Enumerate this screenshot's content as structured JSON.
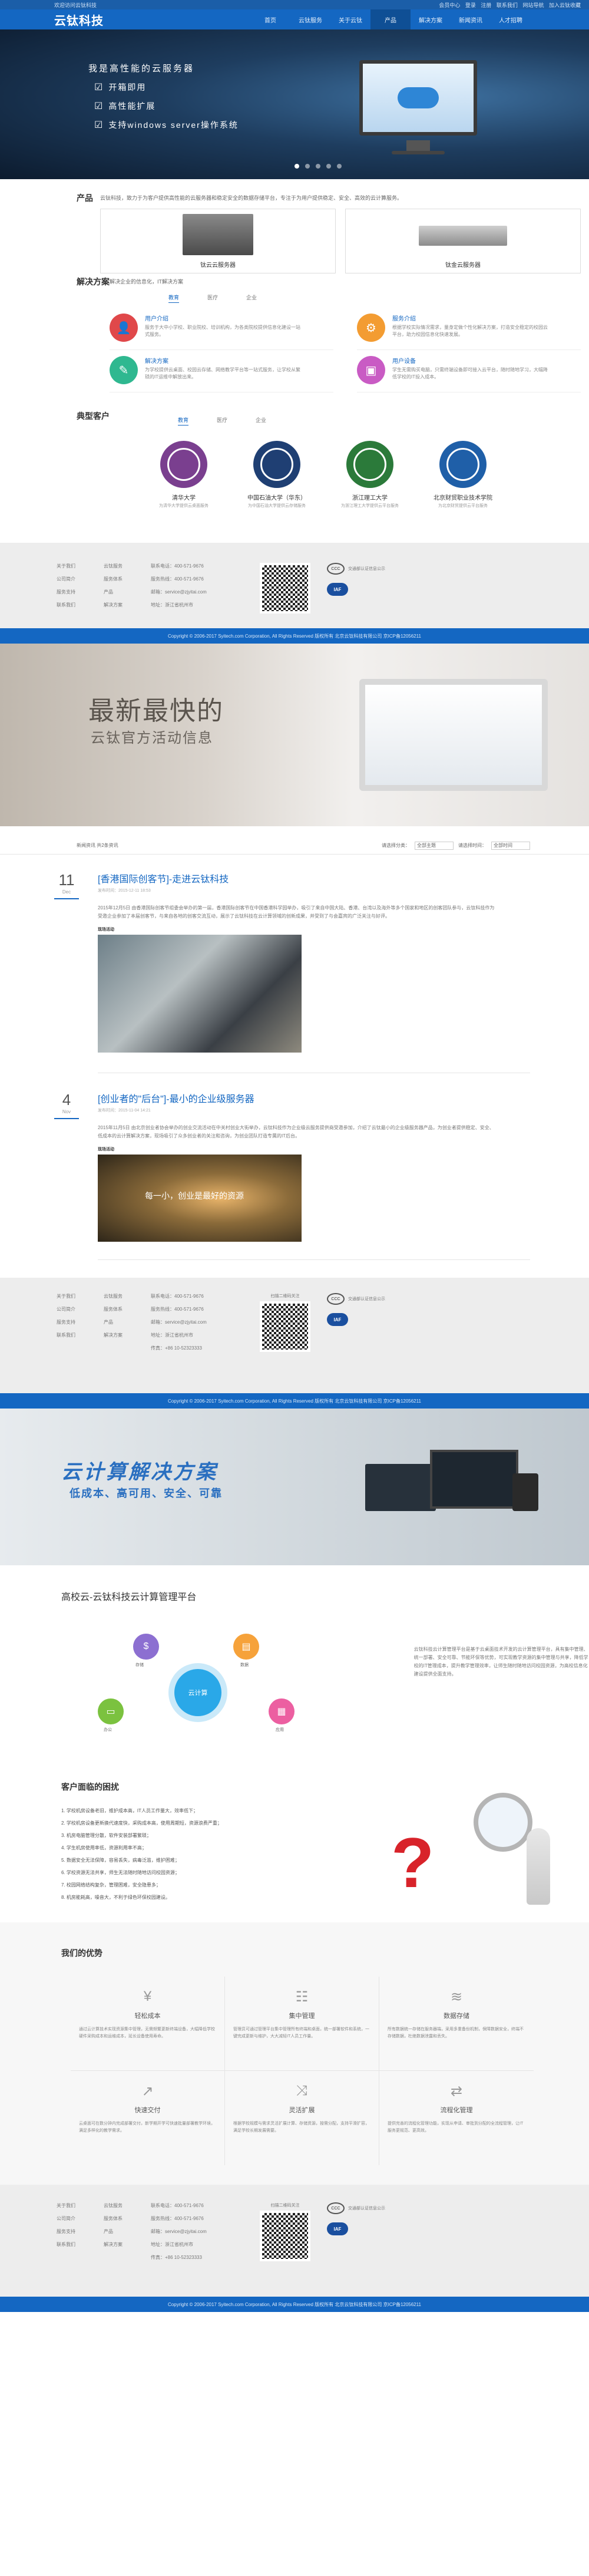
{
  "topbar": {
    "left": "欢迎访问云钛科技",
    "right": [
      "会员中心",
      "登录",
      "注册",
      "联系我们",
      "网站导航",
      "加入云钛收藏"
    ]
  },
  "header": {
    "logo": "云钛科技",
    "nav": [
      "首页",
      "云钛服务",
      "关于云钛",
      "产品",
      "解决方案",
      "新闻资讯",
      "人才招聘"
    ],
    "active_index": 3
  },
  "hero": {
    "title": "我是高性能的云服务器",
    "lines": [
      "开箱即用",
      "高性能扩展",
      "支持windows server操作系统"
    ],
    "slides": 5,
    "active_slide": 0
  },
  "products": {
    "title": "产品",
    "intro": "云钛科技，致力于为客户提供高性能的云服务器和稳定安全的数据存储平台，专注于为用户提供稳定、安全、高效的云计算服务。",
    "items": [
      {
        "name": "钛云云服务器"
      },
      {
        "name": "钛金云服务器"
      }
    ]
  },
  "solutions": {
    "title": "解决方案",
    "intro": "解决企业的信息化，IT解决方案",
    "tabs": [
      "教育",
      "医疗",
      "企业"
    ],
    "active_tab": 0,
    "items": [
      {
        "title": "用户介绍",
        "desc": "服务于大中小学校、职业院校、培训机构，为各类院校提供信息化建设一站式服务。",
        "color": "#e0484a",
        "icon": "user-icon"
      },
      {
        "title": "服务介绍",
        "desc": "根据学校实际情况需求，量身定做个性化解决方案，打造安全稳定的校园云平台，助力校园信息化快速发展。",
        "color": "#f39c32",
        "icon": "service-icon"
      },
      {
        "title": "解决方案",
        "desc": "为学校提供云桌面、校园云存储、网络教学平台等一站式服务，让学校从繁琐的IT运维中解放出来。",
        "color": "#2fb890",
        "icon": "solution-icon"
      },
      {
        "title": "用户设备",
        "desc": "学生无需购买电脑，只需终端设备即可接入云平台，随时随地学习，大幅降低学校的IT投入成本。",
        "color": "#c95bc4",
        "icon": "device-icon"
      }
    ]
  },
  "customers": {
    "title": "典型客户",
    "tabs": [
      "教育",
      "医疗",
      "企业"
    ],
    "active_tab": 0,
    "items": [
      {
        "name": "清华大学",
        "sub": "为清华大学提供云桌面服务",
        "color": "#7a3f8f"
      },
      {
        "name": "中国石油大学（华东）",
        "sub": "为中国石油大学提供云存储服务",
        "color": "#1f3f73"
      },
      {
        "name": "浙江理工大学",
        "sub": "为浙江理工大学提供云平台服务",
        "color": "#2b7a3a"
      },
      {
        "name": "北京财贸职业技术学院",
        "sub": "为北京财贸提供云平台服务",
        "color": "#1f5fa8"
      }
    ]
  },
  "footer": {
    "col1": [
      "关于我们",
      "公司简介",
      "服务支持",
      "联系我们"
    ],
    "col2": [
      "云钛服务",
      "服务体系",
      "产品",
      "解决方案"
    ],
    "contact": [
      "联系电话：400-571-9676",
      "服务热线：400-571-9676",
      "邮箱：service@zjyitai.com",
      "地址：浙江省杭州市",
      "传真：+86 10-52323333"
    ],
    "qr_label": "扫描二维码关注",
    "badge1": "交通部认证信息公示",
    "badge2": "IAF",
    "copyright": "Copyright © 2006-2017 Syitech.com Corporation, All Rights Reserved 版权所有 北京云钛科技有限公司 京ICP备12056211"
  },
  "news": {
    "banner_line1": "最新最快的",
    "banner_line2": "云钛官方活动信息",
    "filter_left": "新闻资讯 共2条资讯",
    "filter_label1": "请选择分类：",
    "filter_value1": "全部主题",
    "filter_label2": "请选择时间：",
    "filter_value2": "全部时间",
    "articles": [
      {
        "day": "11",
        "month": "Dec",
        "title": "[香港国际创客节]-走进云钛科技",
        "meta": "发布时间：2015-12-11 18:53",
        "text": "2015年12月5日 由香港国际创客节组委会举办的第一届，香港国际创客节在中国香港科学园举办，吸引了来自中国大陆、香港、台湾以及海外等多个国家和地区的创客团队参与，云钛科技作为受邀企业参加了本届创客节，与来自各地的创客交流互动，展示了云钛科技在云计算领域的创新成果，并受到了与会嘉宾的广泛关注与好评。",
        "caption": "现场活动"
      },
      {
        "day": "4",
        "month": "Nov",
        "title": "[创业者的\"后台\"]-最小的企业级服务器",
        "meta": "发布时间：2015-11-04 14:21",
        "text": "2015年11月5日 由北京创业者协会举办的创业交流活动在中关村创业大街举办，云钛科技作为企业级云服务提供商受邀参加，介绍了云钛最小的企业级服务器产品，为创业者提供稳定、安全、低成本的云计算解决方案，现场吸引了众多创业者的关注和咨询，为创业团队打造专属的IT后台。",
        "caption": "现场活动",
        "photo_text": "每一小，创业是最好的资源"
      }
    ]
  },
  "cloud": {
    "banner_title": "云计算解决方案",
    "banner_sub": "低成本、高可用、安全、可靠",
    "section_title": "高校云-云钛科技云计算管理平台",
    "center": "云计算",
    "nodes": [
      {
        "label": "存储",
        "color": "#8c6fd1",
        "icon": "storage-icon"
      },
      {
        "label": "数据",
        "color": "#f6a23a",
        "icon": "data-icon"
      },
      {
        "label": "办公",
        "color": "#7bc23f",
        "icon": "office-icon"
      },
      {
        "label": "应用",
        "color": "#ec5fa1",
        "icon": "app-icon"
      }
    ],
    "text": "云钛科技云计算管理平台是基于云桌面技术开发的云计算管理平台，具有集中管理、统一部署、安全可靠、节能环保等优势，可实现教学资源的集中管理与共享，降低学校的IT管理成本，提升教学管理效率，让师生随时随地访问校园资源，为高校信息化建设提供全面支持。",
    "problems_title": "客户面临的困扰",
    "problems": [
      "1. 学校机房设备老旧，维护成本高，IT人员工作量大，效率低下；",
      "2. 学校机房设备更新换代速度快，采购成本高，使用周期短，资源浪费严重；",
      "3. 机房电脑管理分散，软件安装部署繁琐；",
      "4. 学生机房使用率低，资源利用率不高；",
      "5. 数据安全无法保障，容易丢失，病毒泛滥，维护困难；",
      "6. 学校资源无法共享，师生无法随时随地访问校园资源；",
      "7. 校园网络结构复杂，管理困难，安全隐患多；",
      "8. 机房能耗高，噪音大，不利于绿色环保校园建设。"
    ],
    "advantages_title": "我们的优势",
    "advantages": [
      {
        "name": "轻松成本",
        "icon": "money-icon",
        "desc": "通过云计算技术实现资源集中管理，无需频繁更新终端设备，大幅降低学校硬件采购成本和运维成本，延长设备使用寿命。"
      },
      {
        "name": "集中管理",
        "icon": "manage-icon",
        "desc": "管理员可通过管理平台集中管理所有终端和桌面，统一部署软件和系统，一键完成更新与维护，大大减轻IT人员工作量。"
      },
      {
        "name": "数据存储",
        "icon": "database-icon",
        "desc": "所有数据统一存储在服务器端，采用多重备份机制，保障数据安全，终端不存储数据，杜绝数据泄露和丢失。"
      },
      {
        "name": "快速交付",
        "icon": "delivery-icon",
        "desc": "云桌面可在数分钟内完成部署交付，新学期开学可快速批量部署教学环境，满足多样化的教学需求。"
      },
      {
        "name": "灵活扩展",
        "icon": "expand-icon",
        "desc": "根据学校规模与需求灵活扩展计算、存储资源，按需分配，支持平滑扩容，满足学校长期发展需要。"
      },
      {
        "name": "流程化管理",
        "icon": "flow-icon",
        "desc": "提供完善的流程化管理功能，实现从申请、审批到分配的全流程管理，让IT服务更规范、更高效。"
      }
    ]
  }
}
